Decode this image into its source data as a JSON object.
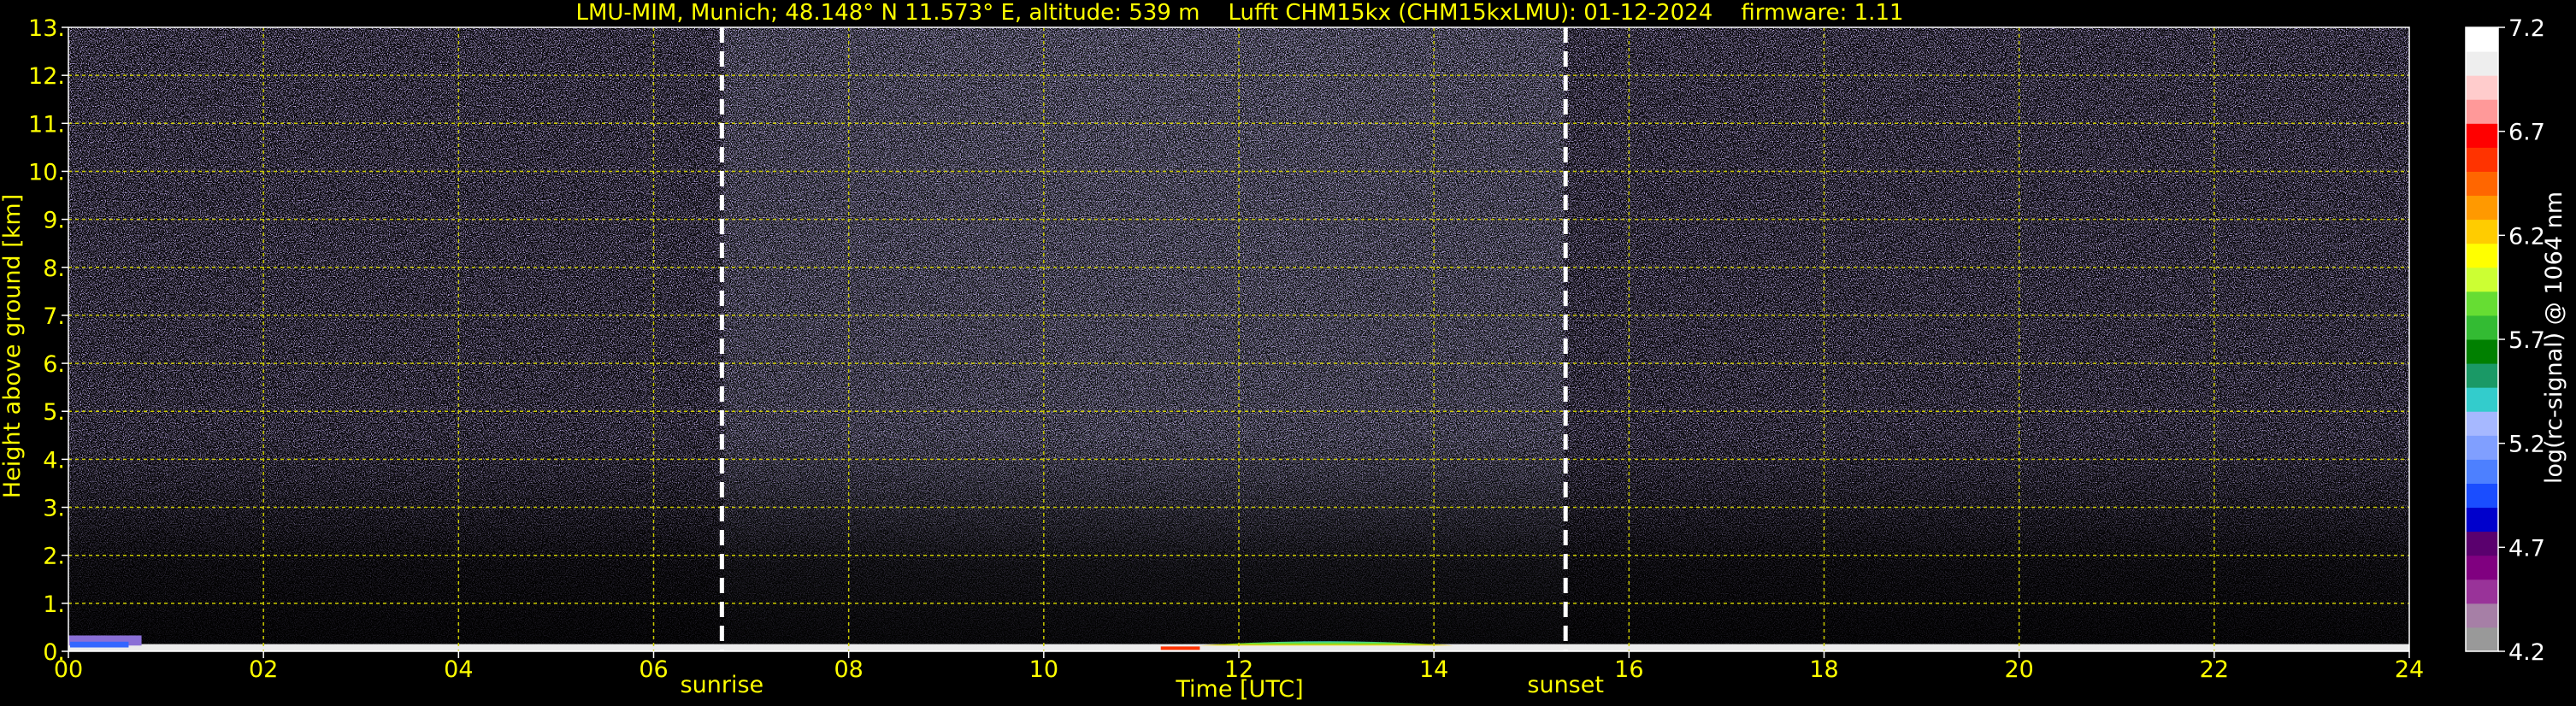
{
  "chart_data": {
    "type": "heatmap",
    "title": "LMU-MIM, Munich; 48.148° N 11.573° E, altitude: 539 m    Lufft CHM15kx (CHM15kxLMU): 01-12-2024    firmware: 1.11",
    "xlabel": "Time [UTC]",
    "ylabel": "Height above ground [km]",
    "xlim": [
      0,
      24
    ],
    "ylim": [
      0,
      13
    ],
    "x_ticks": [
      "00",
      "02",
      "04",
      "06",
      "08",
      "10",
      "12",
      "14",
      "16",
      "18",
      "20",
      "22",
      "24"
    ],
    "y_ticks": [
      "0.",
      "1.",
      "2.",
      "3.",
      "4.",
      "5.",
      "6.",
      "7.",
      "8.",
      "9.",
      "10.",
      "11.",
      "12.",
      "13."
    ],
    "grid": true,
    "annotations": [
      {
        "text": "sunrise",
        "x": 6.7
      },
      {
        "text": "sunset",
        "x": 15.35
      }
    ],
    "colorbar": {
      "label": "log(rc-signal) @ 1064 nm",
      "range": [
        4.2,
        7.2
      ],
      "ticks": [
        "7.2",
        "6.7",
        "6.2",
        "5.7",
        "5.2",
        "4.7",
        "4.2"
      ]
    },
    "features": {
      "noise_top_km": 13,
      "daylight_noise": [
        6.7,
        15.35
      ],
      "surface_layer_km": 0.15,
      "low_layer": {
        "x": [
          11.6,
          14.2
        ],
        "top_km": 0.3
      }
    }
  },
  "colors": {
    "text": "#ffff00",
    "grid": "#cccc00",
    "background": "#000000",
    "sun_line": "#ffffff",
    "colorbar_scale": [
      "#999999",
      "#a67fa6",
      "#993399",
      "#800080",
      "#5a006e",
      "#0000cc",
      "#1a4dff",
      "#4d80ff",
      "#809fff",
      "#a6b8ff",
      "#33cccc",
      "#1a9966",
      "#008000",
      "#33bb33",
      "#66dd33",
      "#ccff33",
      "#ffff00",
      "#ffcc00",
      "#ff9900",
      "#ff6600",
      "#ff3300",
      "#ff0000",
      "#ff9999",
      "#ffcccc",
      "#eeeeee",
      "#ffffff"
    ]
  }
}
